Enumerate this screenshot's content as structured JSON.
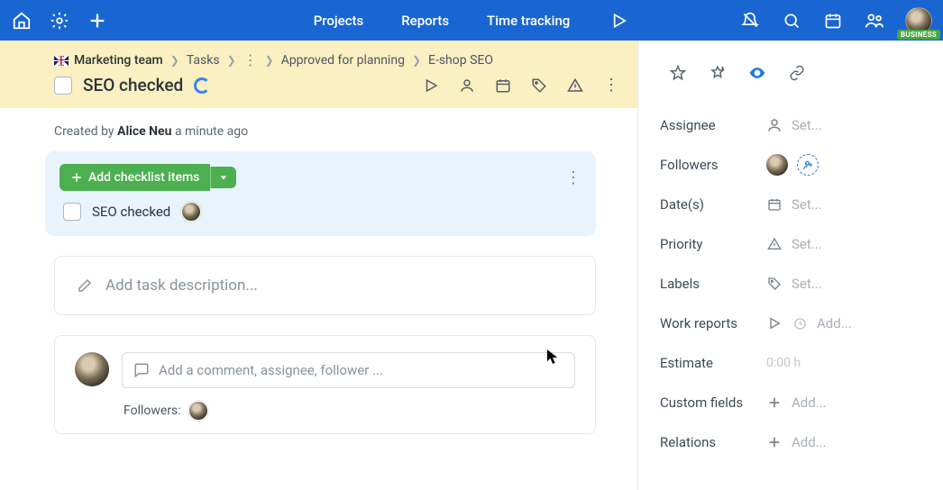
{
  "nav": {
    "projects": "Projects",
    "reports": "Reports",
    "time": "Time tracking"
  },
  "avatar_badge": "BUSINESS",
  "crumbs": {
    "team": "Marketing team",
    "tasks": "Tasks",
    "approved": "Approved for planning",
    "page": "E-shop SEO"
  },
  "task": {
    "title": "SEO checked"
  },
  "created": {
    "prefix": "Created by ",
    "author": "Alice Neu",
    "suffix": " a minute ago"
  },
  "checklist": {
    "add_label": "Add checklist items",
    "items": [
      {
        "label": "SEO checked"
      }
    ]
  },
  "description_placeholder": "Add task description...",
  "comment": {
    "placeholder": "Add a comment, assignee, follower ...",
    "followers_label": "Followers:"
  },
  "side": {
    "assignee": {
      "label": "Assignee",
      "value": "Set..."
    },
    "followers": {
      "label": "Followers"
    },
    "dates": {
      "label": "Date(s)",
      "value": "Set..."
    },
    "priority": {
      "label": "Priority",
      "value": "Set..."
    },
    "labels": {
      "label": "Labels",
      "value": "Set..."
    },
    "workreports": {
      "label": "Work reports",
      "value": "Add..."
    },
    "estimate": {
      "label": "Estimate",
      "value": "0:00 h"
    },
    "custom": {
      "label": "Custom fields",
      "value": "Add..."
    },
    "relations": {
      "label": "Relations",
      "value": "Add..."
    }
  }
}
